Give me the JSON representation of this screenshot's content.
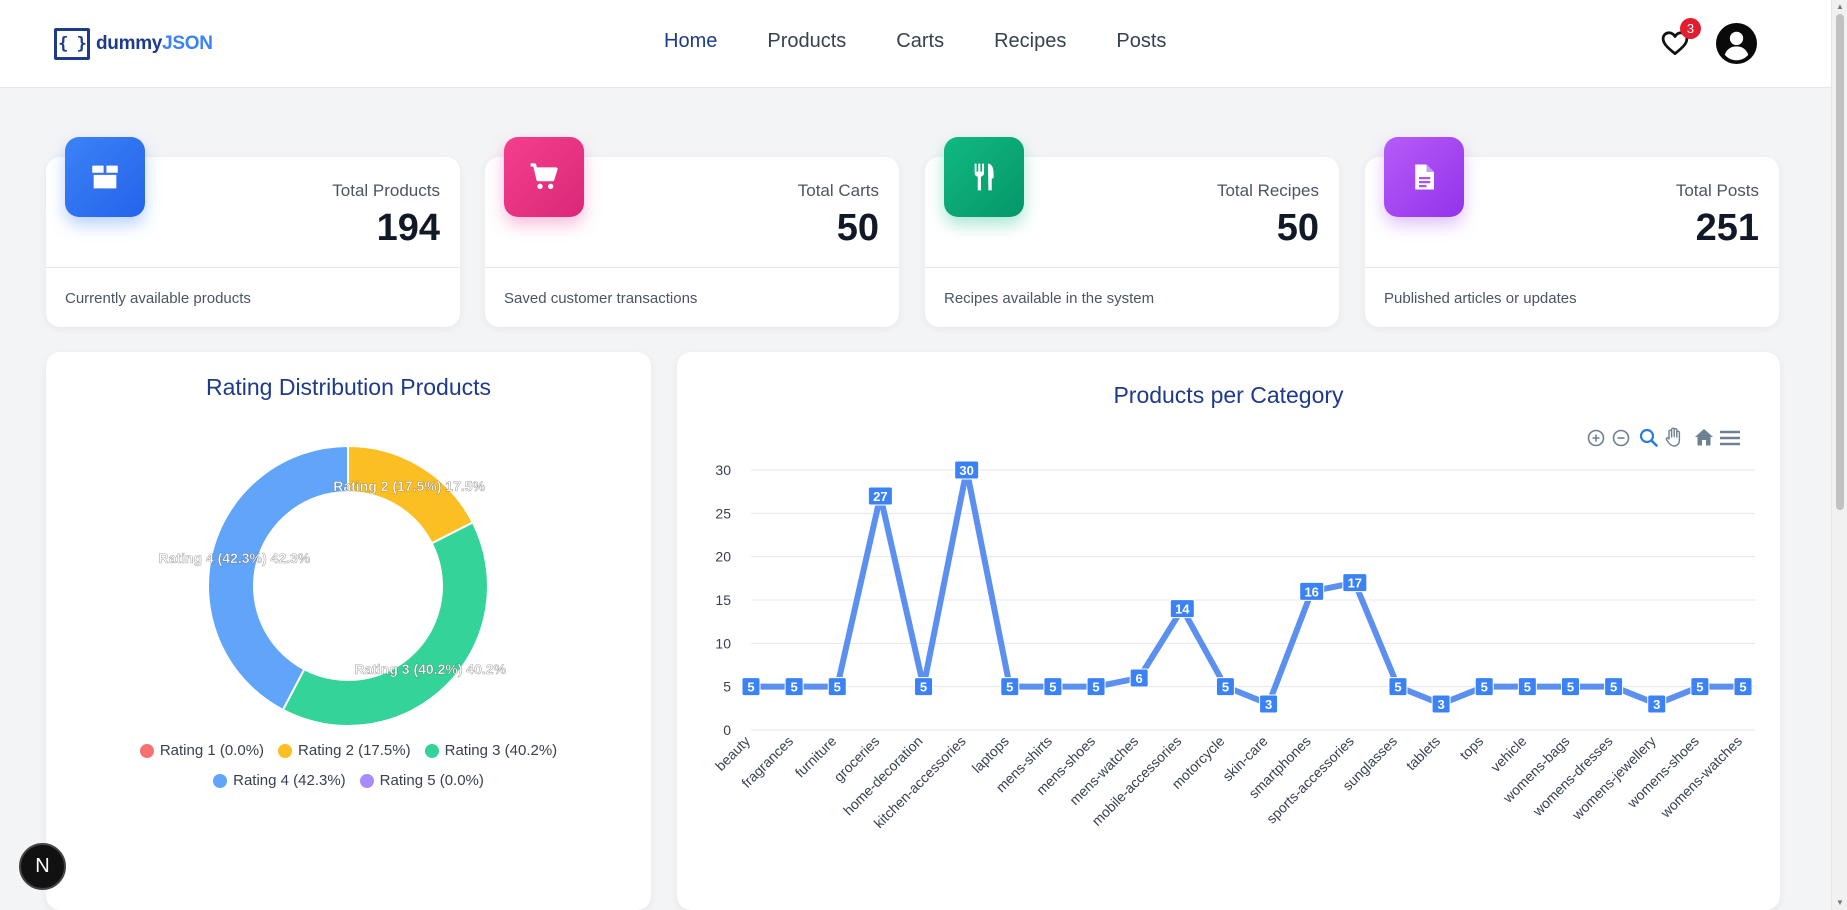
{
  "nav": {
    "logo_brace": "{ }",
    "logo_prefix": "dummy",
    "logo_accent": "JSON",
    "links": [
      "Home",
      "Products",
      "Carts",
      "Recipes",
      "Posts"
    ],
    "wishlist_count": "3"
  },
  "stats": [
    {
      "label": "Total Products",
      "value": "194",
      "foot": "Currently available products",
      "color": "#3b82f6",
      "icon": "box-icon"
    },
    {
      "label": "Total Carts",
      "value": "50",
      "foot": "Saved customer transactions",
      "color": "#ec4899",
      "icon": "cart-icon"
    },
    {
      "label": "Total Recipes",
      "value": "50",
      "foot": "Recipes available in the system",
      "color": "#10b981",
      "icon": "utensils-icon"
    },
    {
      "label": "Total Posts",
      "value": "251",
      "foot": "Published articles or updates",
      "color": "#a855f7",
      "icon": "document-icon"
    }
  ],
  "donut": {
    "title": "Rating Distribution Products",
    "legend": [
      {
        "label": "Rating 1 (0.0%)",
        "color": "#f87171"
      },
      {
        "label": "Rating 2 (17.5%)",
        "color": "#fbbf24"
      },
      {
        "label": "Rating 3 (40.2%)",
        "color": "#34d399"
      },
      {
        "label": "Rating 4 (42.3%)",
        "color": "#60a5fa"
      },
      {
        "label": "Rating 5 (0.0%)",
        "color": "#a78bfa"
      }
    ],
    "slice_labels": [
      "Rating 2 (17.5%) 17.5%",
      "Rating 3 (40.2%) 40.2%",
      "Rating 4 (42.3%) 42.3%"
    ]
  },
  "chart_data": {
    "type": "line",
    "title": "Products per Category",
    "categories": [
      "beauty",
      "fragrances",
      "furniture",
      "groceries",
      "home-decoration",
      "kitchen-accessories",
      "laptops",
      "mens-shirts",
      "mens-shoes",
      "mens-watches",
      "mobile-accessories",
      "motorcycle",
      "skin-care",
      "smartphones",
      "sports-accessories",
      "sunglasses",
      "tablets",
      "tops",
      "vehicle",
      "womens-bags",
      "womens-dresses",
      "womens-jewellery",
      "womens-shoes",
      "womens-watches"
    ],
    "values": [
      5,
      5,
      5,
      27,
      5,
      30,
      5,
      5,
      5,
      6,
      14,
      5,
      3,
      16,
      17,
      5,
      3,
      5,
      5,
      5,
      5,
      3,
      5,
      5
    ],
    "yticks": [
      0,
      5,
      10,
      15,
      20,
      25,
      30
    ],
    "ylim": [
      0,
      30
    ],
    "grid": true,
    "color": "#5b8ff0",
    "pie": {
      "type": "pie",
      "categories": [
        "Rating 1",
        "Rating 2",
        "Rating 3",
        "Rating 4",
        "Rating 5"
      ],
      "values": [
        0.0,
        17.5,
        40.2,
        42.3,
        0.0
      ]
    }
  }
}
